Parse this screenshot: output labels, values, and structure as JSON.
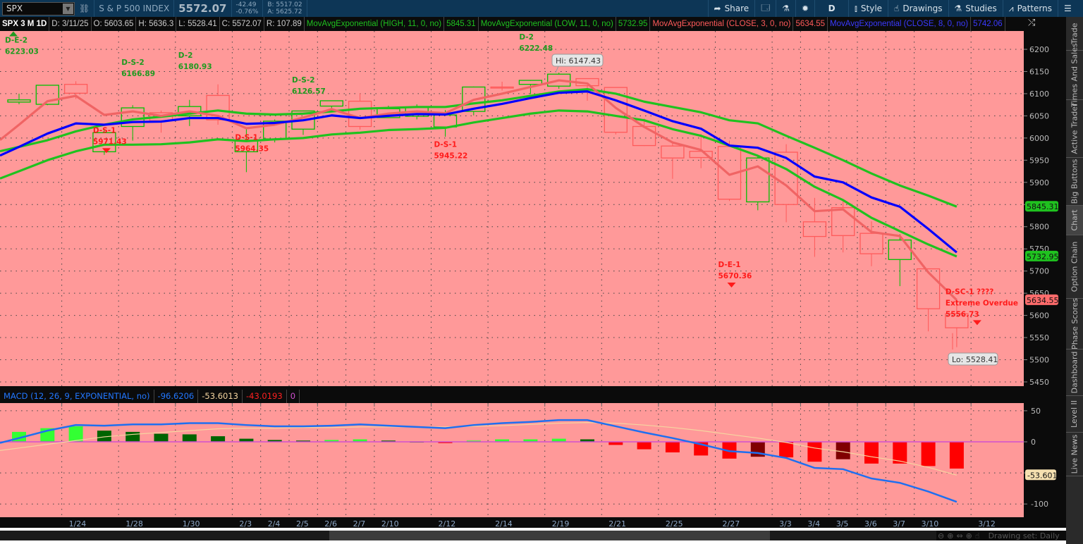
{
  "topbar": {
    "symbol": "SPX",
    "name": "S & P 500 INDEX",
    "last": "5572.07",
    "change": "-42.49",
    "change_pct": "-0.76%",
    "bid": "B: 5517.02",
    "ask": "A: 5625.72",
    "buttons": [
      {
        "label": "Share",
        "icon": "share-icon"
      },
      {
        "label": "",
        "icon": "alert-icon"
      },
      {
        "label": "",
        "icon": "flask-icon"
      },
      {
        "label": "",
        "icon": "gear-icon"
      },
      {
        "label": "D",
        "icon": ""
      },
      {
        "label": "Style",
        "icon": "candle-icon"
      },
      {
        "label": "Drawings",
        "icon": "pointer-hand-icon"
      },
      {
        "label": "Studies",
        "icon": "flask-icon"
      },
      {
        "label": "Patterns",
        "icon": "pattern-icon"
      },
      {
        "label": "",
        "icon": "menu-icon"
      }
    ]
  },
  "header": {
    "title": "SPX 3 M 1D",
    "date": "D: 3/11/25",
    "open": "O: 5603.65",
    "high": "H: 5636.3",
    "low": "L: 5528.41",
    "close": "C: 5572.07",
    "range": "R: 107.89",
    "studies": [
      {
        "label": "MovAvgExponential (HIGH, 11, 0, no)",
        "value": "5845.31",
        "color": "#1fc21f"
      },
      {
        "label": "MovAvgExponential (LOW, 11, 0, no)",
        "value": "5732.95",
        "color": "#1fc21f"
      },
      {
        "label": "MovAvgExponential (CLOSE, 3, 0, no)",
        "value": "5634.55",
        "color": "#ff5a5a"
      },
      {
        "label": "MovAvgExponential (CLOSE, 8, 0, no)",
        "value": "5742.06",
        "color": "#1a1aff"
      }
    ]
  },
  "macd_header": {
    "label": "MACD (12, 26, 9, EXPONENTIAL, no)",
    "value": "-96.6206",
    "avg": "-53.6013",
    "diff": "-43.0193",
    "zero": "0"
  },
  "colors": {
    "background": "#ff9999",
    "up": "#00c000",
    "down": "#ff5a5a",
    "ema_high_low": "#1fc21f",
    "ema3": "#f06464",
    "ema8": "#0000ff",
    "macd": "#1e6ff0",
    "signal": "#f5d5a0"
  },
  "chart_data": [
    {
      "type": "candlestick",
      "price_axis": {
        "ticks": [
          6200,
          6150,
          6100,
          6050,
          6000,
          5950,
          5900,
          5850,
          5800,
          5750,
          5700,
          5650,
          5600,
          5550,
          5500,
          5450
        ],
        "range": [
          5440,
          6245
        ]
      },
      "date_labels": [
        [
          "1/24",
          2
        ],
        [
          "1/28",
          4
        ],
        [
          "1/30",
          6
        ],
        [
          "2/3",
          8
        ],
        [
          "2/4",
          9
        ],
        [
          "2/5",
          10
        ],
        [
          "2/6",
          11
        ],
        [
          "2/7",
          12
        ],
        [
          "2/10",
          13
        ],
        [
          "2/12",
          15
        ],
        [
          "2/14",
          17
        ],
        [
          "2/19",
          19
        ],
        [
          "2/21",
          21
        ],
        [
          "2/25",
          23
        ],
        [
          "2/27",
          25
        ],
        [
          "3/3",
          27
        ],
        [
          "3/4",
          28
        ],
        [
          "3/5",
          29
        ],
        [
          "3/6",
          30
        ],
        [
          "3/7",
          31
        ],
        [
          "3/10",
          32
        ],
        [
          "3/12",
          34
        ]
      ],
      "candles": [
        [
          "1/22",
          6081,
          6100,
          6076,
          6086
        ],
        [
          "1/23",
          6076,
          6119,
          6074,
          6119
        ],
        [
          "1/24",
          6121,
          6128,
          6088,
          6101
        ],
        [
          "1/27",
          5969,
          6017,
          5962,
          6012
        ],
        [
          "1/28",
          6026,
          6074,
          5994,
          6068
        ],
        [
          "1/29",
          6057,
          6062,
          6012,
          6039
        ],
        [
          "1/30",
          6050,
          6086,
          6027,
          6071
        ],
        [
          "1/31",
          6096,
          6121,
          6030,
          6041
        ],
        [
          "2/3",
          5969,
          6022,
          5923,
          5995
        ],
        [
          "2/4",
          5998,
          6042,
          5990,
          6038
        ],
        [
          "2/5",
          6020,
          6062,
          6007,
          6061
        ],
        [
          "2/6",
          6072,
          6084,
          6061,
          6084
        ],
        [
          "2/7",
          6083,
          6101,
          6019,
          6026
        ],
        [
          "2/10",
          6046,
          6073,
          6045,
          6066
        ],
        [
          "2/11",
          6049,
          6076,
          6042,
          6069
        ],
        [
          "2/12",
          6025,
          6063,
          6003,
          6052
        ],
        [
          "2/13",
          6060,
          6116,
          6051,
          6115
        ],
        [
          "2/14",
          6115,
          6127,
          6107,
          6114
        ],
        [
          "2/18",
          6121,
          6129,
          6099,
          6130
        ],
        [
          "2/19",
          6117,
          6147.43,
          6111,
          6144
        ],
        [
          "2/20",
          6134,
          6134,
          6084,
          6118
        ],
        [
          "2/21",
          6114,
          6114,
          6008,
          6013
        ],
        [
          "2/24",
          6026,
          6044,
          5982,
          5983
        ],
        [
          "2/25",
          5982,
          5992,
          5908,
          5955
        ],
        [
          "2/26",
          5970,
          6009,
          5932,
          5956
        ],
        [
          "2/27",
          5981,
          5994,
          5858,
          5862
        ],
        [
          "2/28",
          5856,
          5959,
          5837,
          5955
        ],
        [
          "3/3",
          5968,
          5986,
          5810,
          5850
        ],
        [
          "3/4",
          5811,
          5865,
          5732,
          5778
        ],
        [
          "3/5",
          5843,
          5860,
          5742,
          5780
        ],
        [
          "3/6",
          5785,
          5812,
          5711,
          5739
        ],
        [
          "3/7",
          5726,
          5783,
          5666,
          5770
        ],
        [
          "3/10",
          5705,
          5705,
          5564,
          5615
        ],
        [
          "3/11",
          5603.65,
          5636.3,
          5528.41,
          5572.07
        ]
      ],
      "series": [
        {
          "name": "MovAvgExponential (HIGH, 11, 0, no)",
          "color": "#1fc21f",
          "values": [
            5980,
            5995,
            6015,
            6030,
            6042,
            6048,
            6055,
            6062,
            6055,
            6053,
            6055,
            6060,
            6066,
            6068,
            6070,
            6070,
            6078,
            6085,
            6095,
            6105,
            6110,
            6100,
            6082,
            6070,
            6058,
            6040,
            6033,
            6005,
            5978,
            5950,
            5920,
            5893,
            5870,
            5845.31
          ]
        },
        {
          "name": "MovAvgExponential (LOW, 11, 0, no)",
          "color": "#1fc21f",
          "values": [
            5925,
            5950,
            5970,
            5985,
            5985,
            5986,
            5990,
            5997,
            5993,
            5997,
            6000,
            6008,
            6012,
            6018,
            6020,
            6023,
            6035,
            6045,
            6055,
            6062,
            6060,
            6050,
            6040,
            6020,
            6005,
            5983,
            5960,
            5930,
            5890,
            5860,
            5820,
            5790,
            5760,
            5732.95
          ]
        },
        {
          "name": "MovAvgExponential (CLOSE, 3, 0, no)",
          "color": "#f06464",
          "values": [
            6030,
            6083,
            6095,
            6052,
            6060,
            6050,
            6060,
            6050,
            6022,
            6030,
            6046,
            6065,
            6045,
            6055,
            6060,
            6056,
            6086,
            6100,
            6115,
            6130,
            6123,
            6068,
            6025,
            5990,
            5973,
            5917,
            5936,
            5893,
            5835,
            5839,
            5788,
            5779,
            5697,
            5634.55
          ]
        },
        {
          "name": "MovAvgExponential (CLOSE, 8, 0, no)",
          "color": "#0000ff",
          "values": [
            5980,
            6010,
            6033,
            6030,
            6036,
            6037,
            6045,
            6045,
            6032,
            6034,
            6040,
            6051,
            6045,
            6050,
            6054,
            6053,
            6066,
            6077,
            6090,
            6102,
            6105,
            6085,
            6062,
            6038,
            6021,
            5983,
            5978,
            5955,
            5913,
            5900,
            5866,
            5845,
            5795,
            5742.06
          ]
        }
      ],
      "axis_badges": [
        {
          "value": "5845.31",
          "color": "#1fc21f"
        },
        {
          "value": "5732.95",
          "color": "#1fc21f"
        },
        {
          "value": "5634.55",
          "color": "#ff6b6b"
        }
      ],
      "annotations": [
        {
          "lines": [
            "D-E-2",
            "6223.03"
          ],
          "bar": 0,
          "price": 6215,
          "color": "#1f9a1f",
          "marker": "up"
        },
        {
          "lines": [
            "D-S-1",
            "5971.43"
          ],
          "bar": 3,
          "price": 6012,
          "color": "#ff1a1a",
          "marker": "down"
        },
        {
          "lines": [
            "D-S-2",
            "6166.89"
          ],
          "bar": 4,
          "price": 6165,
          "color": "#1f9a1f"
        },
        {
          "lines": [
            "D-2",
            "6180.93"
          ],
          "bar": 6,
          "price": 6181,
          "color": "#1f9a1f"
        },
        {
          "lines": [
            "D-S-1",
            "5964.35"
          ],
          "bar": 8,
          "price": 5996,
          "color": "#ff1a1a"
        },
        {
          "lines": [
            "D-S-2",
            "6126.57"
          ],
          "bar": 10,
          "price": 6125,
          "color": "#1f9a1f"
        },
        {
          "lines": [
            "D-S-1",
            "5945.22"
          ],
          "bar": 15,
          "price": 5980,
          "color": "#ff1a1a"
        },
        {
          "lines": [
            "D-2",
            "6222.48"
          ],
          "bar": 18,
          "price": 6222,
          "color": "#1f9a1f"
        },
        {
          "lines": [
            "D-E-1",
            "5670.36"
          ],
          "bar": 25,
          "price": 5709,
          "color": "#ff1a1a",
          "marker": "down"
        },
        {
          "lines": [
            "D-SC-1 ????",
            "Extreme Overdue",
            "5556.73"
          ],
          "bar": 33,
          "price": 5648,
          "color": "#ff1a1a",
          "marker": "down"
        }
      ],
      "hi_label": "Hi: 6147.43",
      "lo_label": "Lo: 5528.41"
    },
    {
      "type": "macd",
      "axis": {
        "ticks": [
          50,
          0,
          -50,
          -100
        ],
        "range": [
          -108,
          62
        ]
      },
      "signal_badge": "-53.601",
      "macd": [
        6,
        18,
        27,
        26,
        28,
        28,
        30,
        30,
        27,
        25,
        25,
        26,
        28,
        26,
        24,
        22,
        27,
        30,
        32,
        35,
        35,
        25,
        15,
        6,
        -4,
        -15,
        -18,
        -26,
        -42,
        -44,
        -59,
        -66,
        -80,
        -96.62
      ],
      "signal": [
        -10,
        -4,
        2,
        8,
        12,
        15,
        18,
        21,
        22,
        22,
        23,
        23,
        24,
        24,
        24,
        24,
        25,
        26,
        28,
        30,
        31,
        30,
        27,
        23,
        18,
        12,
        6,
        -1,
        -10,
        -16,
        -24,
        -31,
        -41,
        -53.6
      ],
      "histogram": [
        16,
        22,
        25,
        18,
        16,
        13,
        12,
        9,
        5,
        3,
        2,
        3,
        4,
        2,
        0,
        -2,
        2,
        4,
        4,
        5,
        4,
        -5,
        -12,
        -17,
        -22,
        -27,
        -24,
        -25,
        -32,
        -28,
        -35,
        -35,
        -39,
        -43.02
      ]
    }
  ],
  "sidebar": [
    "Trade",
    "Times And Sales",
    "Active Trader",
    "Big Buttons",
    "Chart",
    "Option Chain",
    "Phase Scores",
    "Dashboard",
    "Level II",
    "Live News"
  ],
  "bottom": {
    "drawing_set": "Drawing set: Daily"
  }
}
